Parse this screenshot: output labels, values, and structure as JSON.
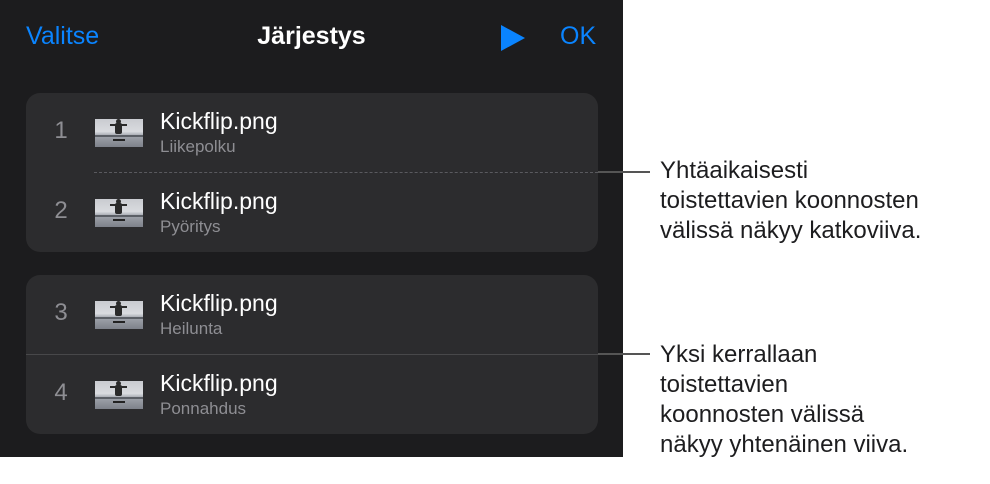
{
  "nav": {
    "select_label": "Valitse",
    "title": "Järjestys",
    "play_icon": "play-icon",
    "ok_label": "OK",
    "accent_color": "#0a84ff"
  },
  "groups": [
    {
      "separator": "dashed",
      "rows": [
        {
          "number": "1",
          "name": "Kickflip.png",
          "effect": "Liikepolku"
        },
        {
          "number": "2",
          "name": "Kickflip.png",
          "effect": "Pyöritys"
        }
      ]
    },
    {
      "separator": "solid",
      "rows": [
        {
          "number": "3",
          "name": "Kickflip.png",
          "effect": "Heilunta"
        },
        {
          "number": "4",
          "name": "Kickflip.png",
          "effect": "Ponnahdus"
        }
      ]
    }
  ],
  "callouts": {
    "dashed": [
      "Yhtäaikaisesti",
      "toistettavien koonnosten",
      "välissä näkyy katkoviiva."
    ],
    "solid": [
      "Yksi kerrallaan",
      "toistettavien",
      "koonnosten välissä",
      "näkyy yhtenäinen viiva."
    ]
  }
}
